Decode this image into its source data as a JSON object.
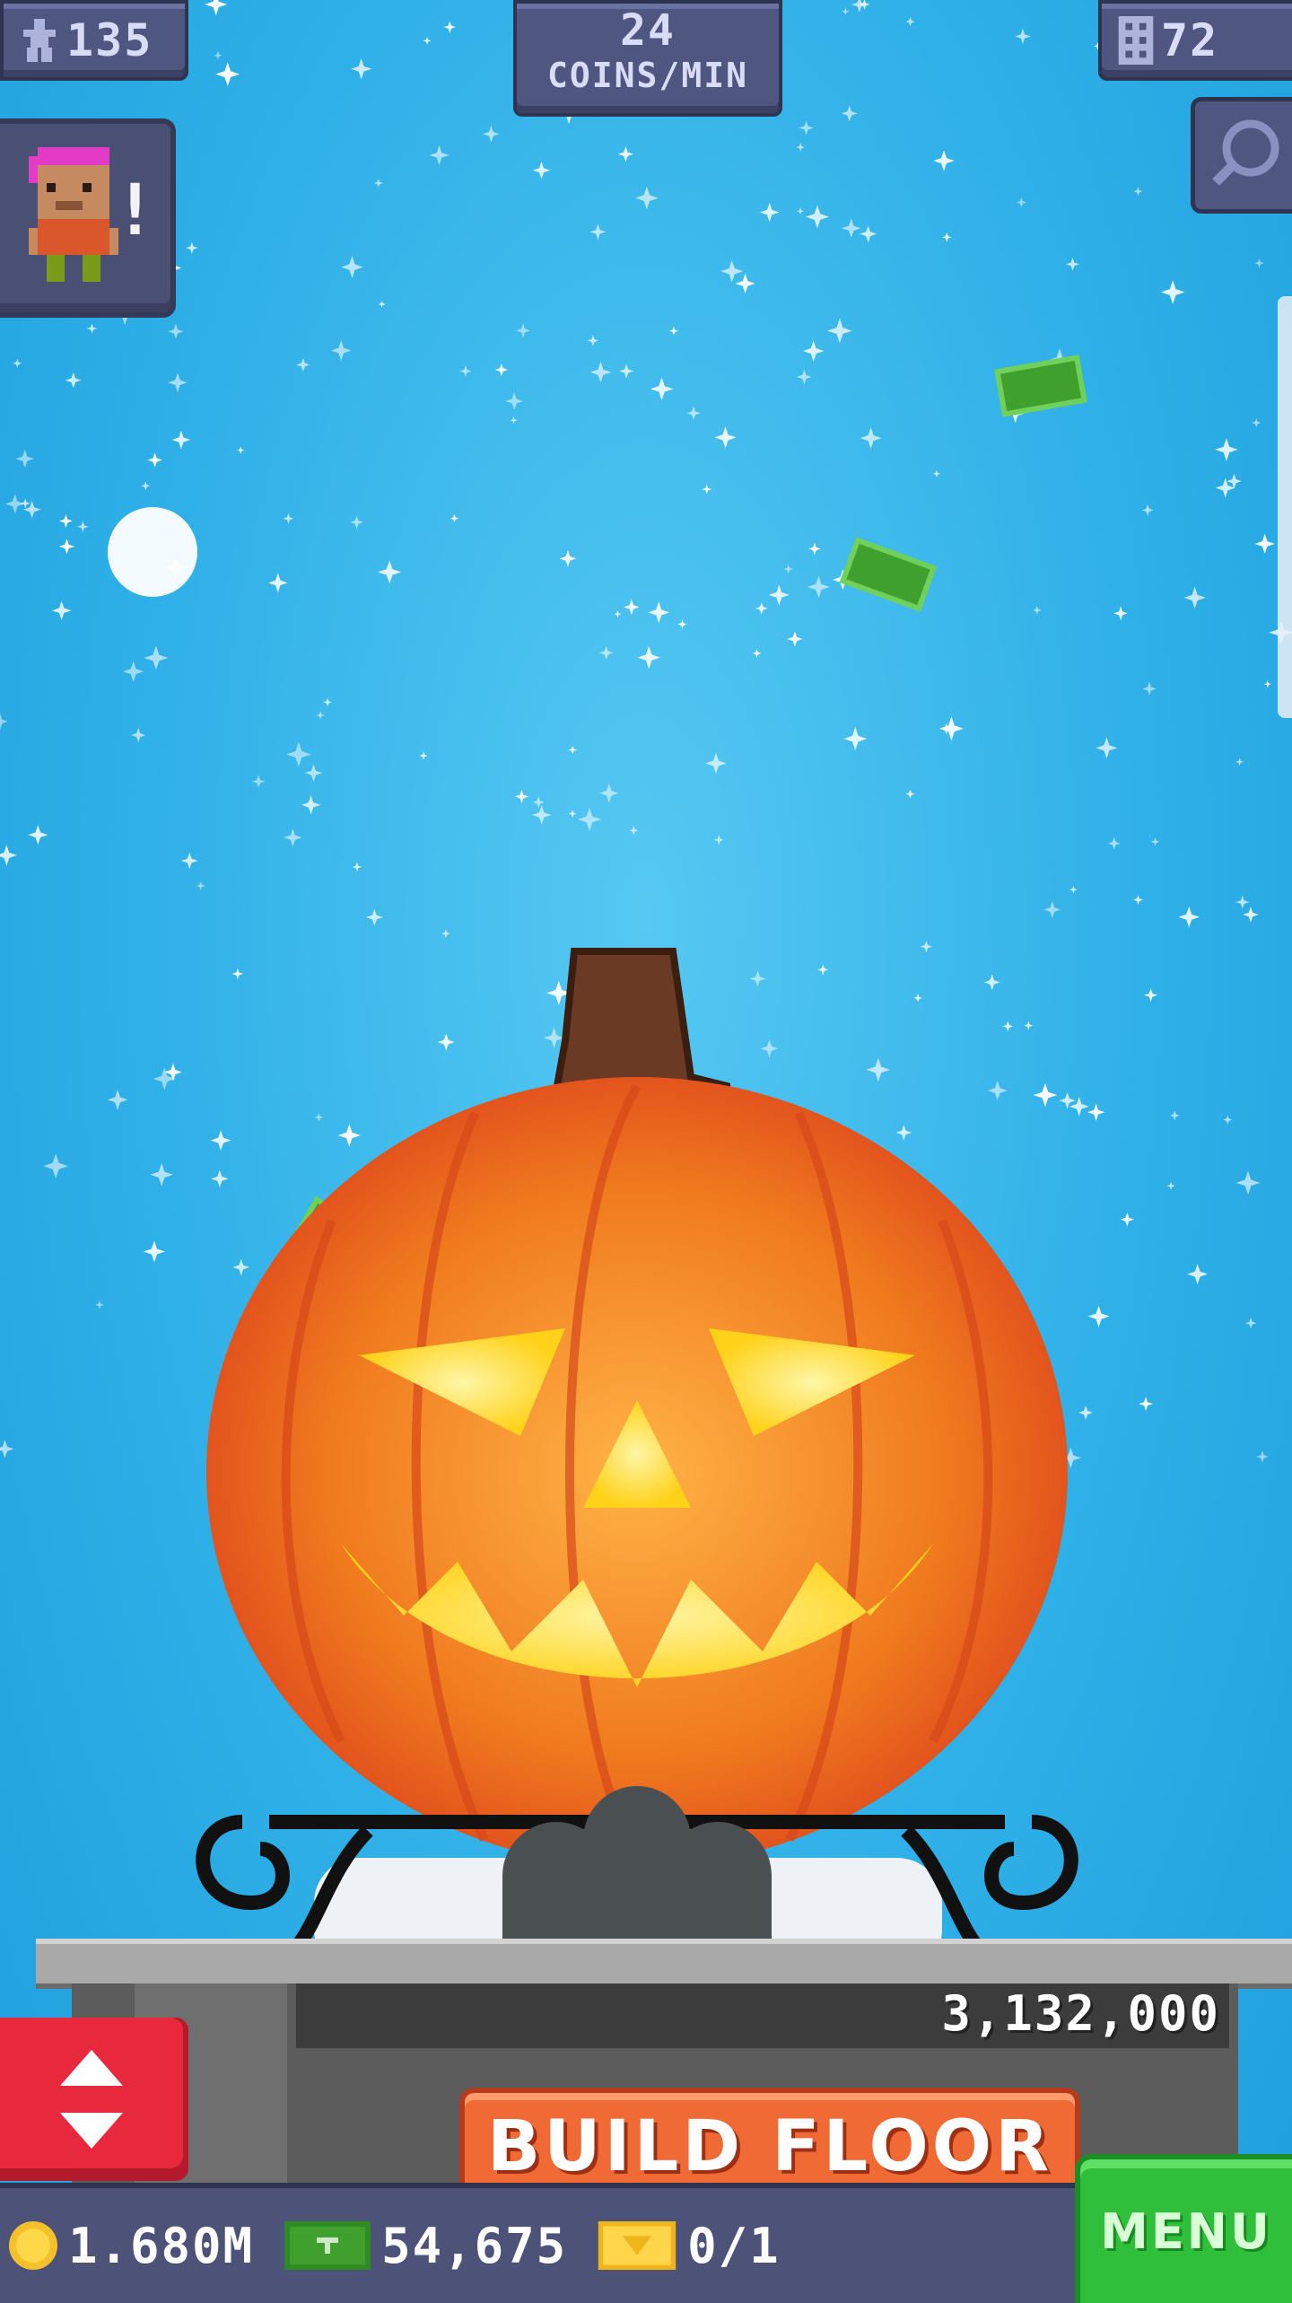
{
  "hud": {
    "residents_count": "135",
    "coins_rate_value": "24",
    "coins_rate_unit": "COINS/MIN",
    "floors_count": "72",
    "vip_alert": "!"
  },
  "build_bar": {
    "floor_price": "3,132,000",
    "build_label": "BUILD FLOOR"
  },
  "bottom": {
    "coins": "1.680M",
    "bux": "54,675",
    "tickets": "0/1",
    "menu_label": "MENU"
  },
  "icons": {
    "residents": "person-icon",
    "floors": "building-icon",
    "search": "magnifier-icon",
    "elevator": "up-down-arrows-icon",
    "coin": "coin-icon",
    "bux": "banknote-icon",
    "ticket": "ticket-icon"
  },
  "colors": {
    "sky": "#2fb0e8",
    "hud": "#4f5680",
    "pumpkin": "#f07a1e",
    "pumpkin_glow": "#ffe13a",
    "build_button": "#f06a36",
    "menu_button": "#2fbf3a",
    "elevator_button": "#e8283d",
    "banknote": "#3fa02e"
  }
}
